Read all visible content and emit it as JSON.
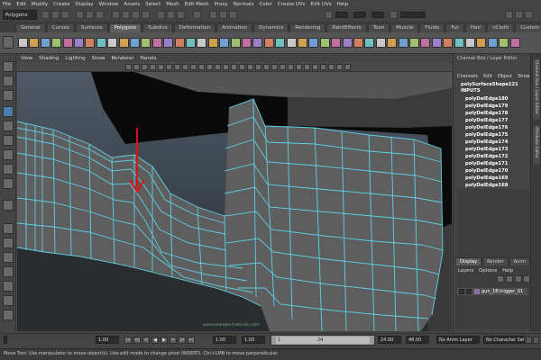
{
  "menu": [
    "File",
    "Edit",
    "Modify",
    "Create",
    "Display",
    "Window",
    "Assets",
    "Select",
    "Mesh",
    "Edit Mesh",
    "Proxy",
    "Normals",
    "Color",
    "Create UVs",
    "Edit UVs",
    "Help"
  ],
  "status_line": {
    "mode": "Polygons"
  },
  "shelf_tabs": [
    "General",
    "Curves",
    "Surfaces",
    "Polygons",
    "Subdivs",
    "Deformation",
    "Animation",
    "Dynamics",
    "Rendering",
    "PaintEffects",
    "Toon",
    "Muscle",
    "Fluids",
    "Fur",
    "Hair",
    "nCloth",
    "Custom"
  ],
  "shelf_active_tab": "Polygons",
  "viewport_menu": [
    "View",
    "Shading",
    "Lighting",
    "Show",
    "Renderer",
    "Panels"
  ],
  "viewport": {
    "watermark": "www.example-tutorials.com"
  },
  "channel_box": {
    "title": "Channel Box / Layer Editor",
    "menu": [
      "Channels",
      "Edit",
      "Object",
      "Show"
    ],
    "shape": "polySurfaceShape121",
    "inputs_label": "INPUTS",
    "history": [
      "polyDelEdge180",
      "polyDelEdge179",
      "polyDelEdge178",
      "polyDelEdge177",
      "polyDelEdge176",
      "polyDelEdge175",
      "polyDelEdge174",
      "polyDelEdge173",
      "polyDelEdge172",
      "polyDelEdge171",
      "polyDelEdge170",
      "polyDelEdge169",
      "polyDelEdge168"
    ]
  },
  "side_tabs": [
    "Channel Box / Layer Editor",
    "Attribute Editor"
  ],
  "layer_editor": {
    "tabs": [
      "Display",
      "Render",
      "Anim"
    ],
    "menu": [
      "Layers",
      "Options",
      "Help"
    ],
    "layer_name": "gun_1B:trigger_01"
  },
  "time": {
    "range_start": "1.00",
    "current_frame": "1.00",
    "playback_start": "1.00",
    "slider_start": "1",
    "slider_end": "24",
    "range_end": "24.00",
    "playback_end": "48.00",
    "anim_layer": "No Anim Layer",
    "character_set": "No Character Set"
  },
  "help_line": "Move Tool: Use manipulator to move object(s). Use edit mode to change pivot (INSERT). Ctrl+LMB to move perpendicular.",
  "colors": {
    "wire": "#5fd0e6",
    "arrow": "#e01010",
    "mesh": "#5e5e5e",
    "bg_top": "#4f5a66",
    "bg_bottom": "#262a2e"
  }
}
